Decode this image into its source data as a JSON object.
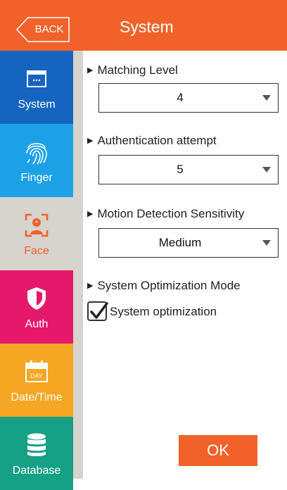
{
  "header": {
    "back_label": "BACK",
    "title": "System"
  },
  "sidebar": {
    "items": [
      {
        "label": "System",
        "icon": "window-icon",
        "color": "#1565c0",
        "active": false
      },
      {
        "label": "Finger",
        "icon": "fingerprint-icon",
        "color": "#1da1e6",
        "active": false
      },
      {
        "label": "Face",
        "icon": "face-scan-icon",
        "color": "#d7d3cd",
        "active": true
      },
      {
        "label": "Auth",
        "icon": "shield-icon",
        "color": "#e6186b",
        "active": false
      },
      {
        "label": "Date/Time",
        "icon": "calendar-icon",
        "color": "#f5a623",
        "active": false
      },
      {
        "label": "Database",
        "icon": "database-icon",
        "color": "#16a085",
        "active": false
      }
    ]
  },
  "settings": {
    "matching_level": {
      "label": "Matching Level",
      "value": "4"
    },
    "auth_attempt": {
      "label": "Authentication attempt",
      "value": "5"
    },
    "motion_sensitivity": {
      "label": "Motion Detection Sensitivity",
      "value": "Medium"
    },
    "optimization_mode": {
      "label": "System Optimization Mode"
    },
    "optimization_checkbox": {
      "label": "System optimization",
      "checked": true
    }
  },
  "ok_label": "OK",
  "colors": {
    "accent": "#f0622a"
  }
}
